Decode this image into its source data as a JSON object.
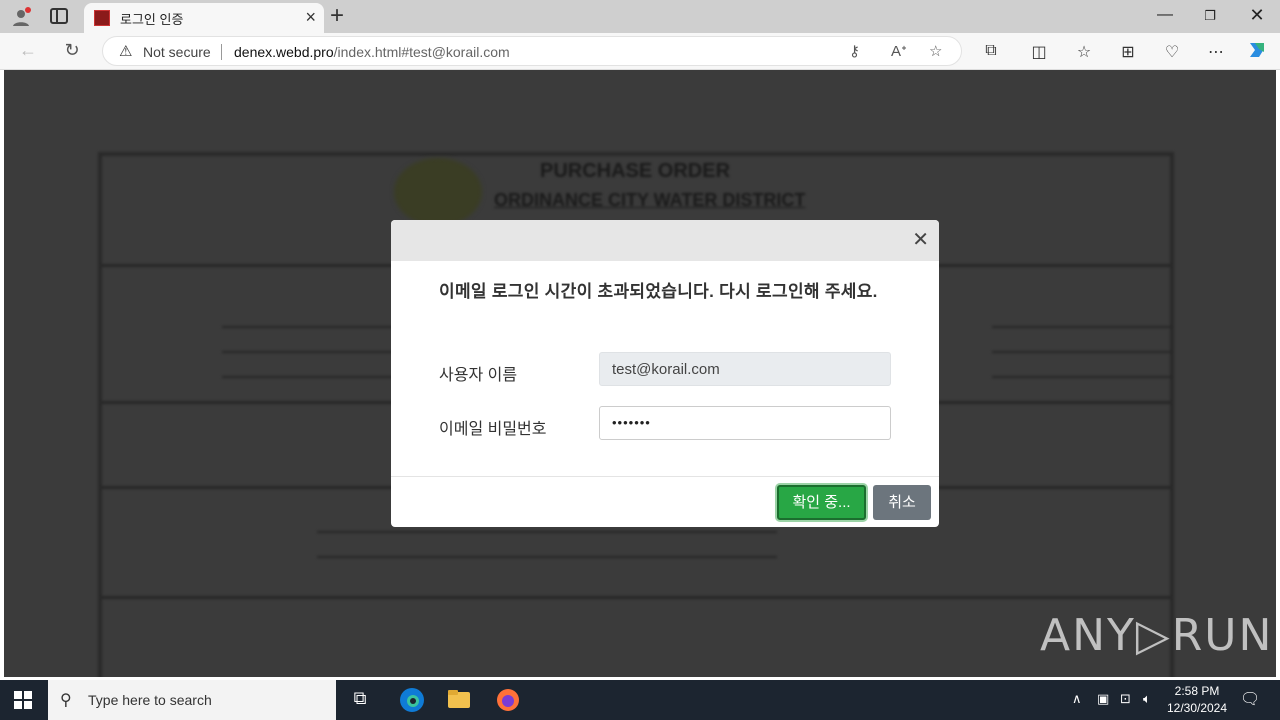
{
  "browser": {
    "tab_title": "로그인 인증",
    "not_secure": "Not secure",
    "url_host": "denex.webd.pro",
    "url_rest": "/index.html#test@korail.com"
  },
  "page": {
    "doc_title": "PURCHASE ORDER",
    "doc_subtitle": "ORDINANCE CITY WATER DISTRICT"
  },
  "modal": {
    "message": "이메일 로그인 시간이 초과되었습니다. 다시 로그인해 주세요.",
    "username_label": "사용자 이름",
    "username_value": "test@korail.com",
    "password_label": "이메일 비밀번호",
    "password_value": "•••••••",
    "confirm_button": "확인 중...",
    "cancel_button": "취소"
  },
  "watermark": "ANY▷RUN",
  "taskbar": {
    "search_placeholder": "Type here to search",
    "time": "2:58 PM",
    "date": "12/30/2024"
  }
}
